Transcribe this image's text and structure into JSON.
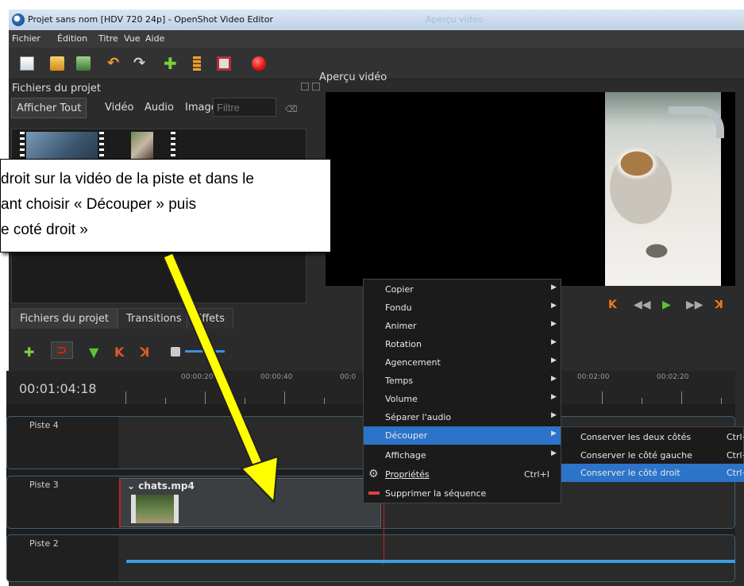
{
  "window": {
    "title": "Projet sans nom [HDV 720 24p] - OpenShot Video Editor",
    "ghost_title": "Aperçu vidéo"
  },
  "menubar": {
    "items": [
      "Fichier",
      "Édition",
      "Titre",
      "Vue",
      "Aide"
    ]
  },
  "toolbar": {
    "icons": [
      "new-project-icon",
      "open-project-icon",
      "save-project-icon",
      "undo-icon",
      "redo-icon",
      "import-files-icon",
      "profile-icon",
      "fullscreen-icon",
      "record-icon"
    ]
  },
  "project_files": {
    "title": "Fichiers du projet",
    "tabs": [
      "Afficher Tout",
      "Vidéo",
      "Audio",
      "Image"
    ],
    "filter_placeholder": "Filtre"
  },
  "bottom_tabs": [
    "Fichiers du projet",
    "Transitions",
    "Effets"
  ],
  "preview": {
    "title": "Aperçu vidéo"
  },
  "timeline": {
    "timecode": "00:01:04:18",
    "ruler": [
      "00:00:20",
      "00:00:40",
      "00:0",
      "00:02:00",
      "00:02:20"
    ],
    "tracks": [
      "Piste 4",
      "Piste 3",
      "Piste 2"
    ],
    "clip": "chats.mp4"
  },
  "callout": {
    "lines": [
      "droit sur la vidéo de la piste et dans le",
      "ant choisir « Découper » puis",
      "e coté droit »"
    ]
  },
  "context_menu": {
    "items": [
      {
        "label": "Copier",
        "submenu": true
      },
      {
        "label": "Fondu",
        "submenu": true
      },
      {
        "label": "Animer",
        "submenu": true
      },
      {
        "label": "Rotation",
        "submenu": true
      },
      {
        "label": "Agencement",
        "submenu": true
      },
      {
        "label": "Temps",
        "submenu": true
      },
      {
        "label": "Volume",
        "submenu": true
      },
      {
        "label": "Séparer l'audio",
        "submenu": true
      },
      {
        "label": "Découper",
        "submenu": true,
        "selected": true
      },
      {
        "label": "Affichage",
        "submenu": true
      },
      {
        "label": "Propriétés",
        "shortcut": "Ctrl+I"
      },
      {
        "label": "Supprimer la séquence"
      }
    ]
  },
  "submenu": {
    "items": [
      {
        "label": "Conserver les deux côtés",
        "shortcut": "Ctrl+"
      },
      {
        "label": "Conserver le côté gauche",
        "shortcut": "Ctrl+"
      },
      {
        "label": "Conserver le côté droit",
        "shortcut": "Ctrl+",
        "selected": true
      }
    ]
  },
  "colors": {
    "accent": "#2c74c9",
    "arrow": "#ffff00",
    "playhead": "#c02020"
  }
}
